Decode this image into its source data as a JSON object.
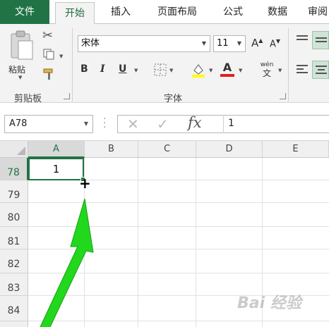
{
  "ribbon_tabs": [
    {
      "label": "文件"
    },
    {
      "label": "开始"
    },
    {
      "label": "插入"
    },
    {
      "label": "页面布局"
    },
    {
      "label": "公式"
    },
    {
      "label": "数据"
    },
    {
      "label": "审阅"
    }
  ],
  "clipboard": {
    "paste_label": "粘贴",
    "group_label": "剪贴板"
  },
  "font": {
    "name": "宋体",
    "size": "11",
    "group_label": "字体",
    "bold": "B",
    "italic": "I",
    "underline": "U",
    "grow": "A",
    "shrink": "A",
    "phonetic": "wén",
    "phonetic_sub": "文"
  },
  "formula_bar": {
    "name_box": "A78",
    "cancel": "✕",
    "enter": "✓",
    "fx": "fx",
    "value": "1"
  },
  "columns": [
    "A",
    "B",
    "C",
    "D",
    "E"
  ],
  "rows": [
    "78",
    "79",
    "80",
    "81",
    "82",
    "83",
    "84"
  ],
  "active_cell": {
    "value": "1"
  },
  "watermark": "Bai 经验",
  "colors": {
    "accent": "#217346",
    "arrow": "#22d81c"
  }
}
